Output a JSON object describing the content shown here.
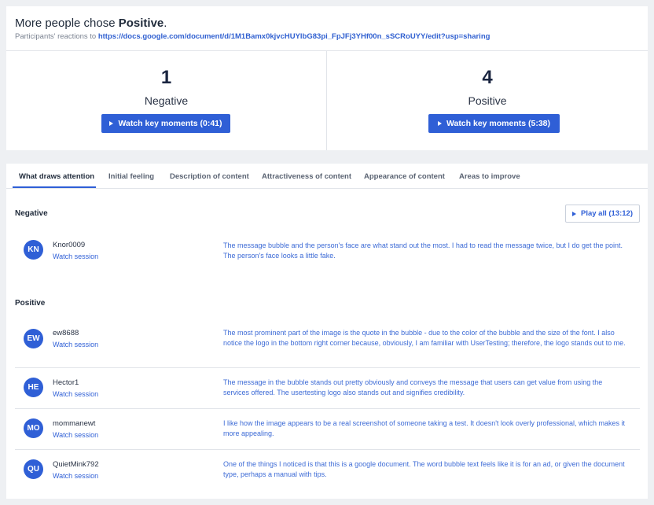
{
  "header": {
    "headline_prefix": "More people chose ",
    "headline_choice": "Positive",
    "headline_suffix": ".",
    "sub_prefix": "Participants' reactions to ",
    "sub_link": "https://docs.google.com/document/d/1M1Bamx0kjvcHUYlbG83pi_FpJFj3YHf00n_sSCRoUYY/edit?usp=sharing"
  },
  "summary": {
    "negative": {
      "count": "1",
      "label": "Negative",
      "button": "Watch key moments (0:41)"
    },
    "positive": {
      "count": "4",
      "label": "Positive",
      "button": "Watch key moments (5:38)"
    }
  },
  "tabs": [
    {
      "label": "What draws attention",
      "active": true
    },
    {
      "label": "Initial feeling"
    },
    {
      "label": "Description of content"
    },
    {
      "label": "Attractiveness of content"
    },
    {
      "label": "Appearance of content"
    },
    {
      "label": "Areas to improve"
    }
  ],
  "negative_section": {
    "title": "Negative",
    "play_all": "Play all (13:12)",
    "rows": [
      {
        "initials": "KN",
        "user": "Knor0009",
        "watch": "Watch session",
        "quote": "The message bubble and the person's face are what stand out the most. I had to read the message twice, but I do get the point. The person's face looks a little fake."
      }
    ]
  },
  "positive_section": {
    "title": "Positive",
    "rows": [
      {
        "initials": "EW",
        "user": "ew8688",
        "watch": "Watch session",
        "quote": "The most prominent part of the image is the quote in the bubble - due to the color of the bubble and the size of the font. I also notice the logo in the bottom right corner because, obviously, I am familiar with UserTesting; therefore, the logo stands out to me."
      },
      {
        "initials": "HE",
        "user": "Hector1",
        "watch": "Watch session",
        "quote": "The message in the bubble stands out pretty obviously and conveys the message that users can get value from using the services offered. The usertesting logo also stands out and signifies credibility."
      },
      {
        "initials": "MO",
        "user": "mommanewt",
        "watch": "Watch session",
        "quote": "I like how the image appears to be a real screenshot of someone taking a test. It doesn't look overly professional, which makes it more appealing."
      },
      {
        "initials": "QU",
        "user": "QuietMink792",
        "watch": "Watch session",
        "quote": "One of the things I noticed is that this is a google document. The word bubble text feels like it is for an ad, or given the document type, perhaps a manual with tips."
      }
    ]
  },
  "colors": {
    "accent": "#2f5fd6",
    "link": "#2f5fd0",
    "background": "#eef0f3"
  }
}
